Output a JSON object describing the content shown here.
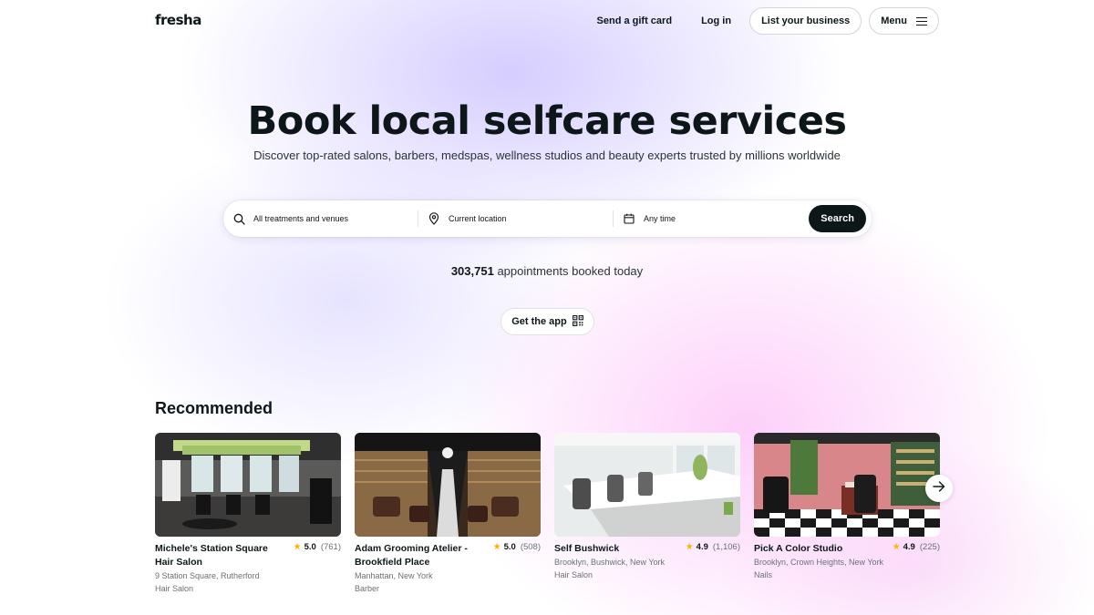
{
  "header": {
    "logo": "fresha",
    "gift_card": "Send a gift card",
    "login": "Log in",
    "list_business": "List your business",
    "menu": "Menu"
  },
  "hero": {
    "title": "Book local selfcare services",
    "subtitle": "Discover top-rated salons, barbers, medspas, wellness studios and beauty experts trusted by millions worldwide"
  },
  "search": {
    "treatments": "All treatments and venues",
    "location": "Current location",
    "time": "Any time",
    "button": "Search"
  },
  "stats": {
    "count": "303,751",
    "label": "appointments booked today"
  },
  "app_button": "Get the app",
  "recommended": {
    "title": "Recommended",
    "cards": [
      {
        "name": "Michele's Station Square Hair Salon",
        "rating": "5.0",
        "reviews": "(761)",
        "address": "9 Station Square, Rutherford",
        "category": "Hair Salon"
      },
      {
        "name": "Adam Grooming Atelier - Brookfield Place",
        "rating": "5.0",
        "reviews": "(508)",
        "address": "Manhattan, New York",
        "category": "Barber"
      },
      {
        "name": "Self Bushwick",
        "rating": "4.9",
        "reviews": "(1,106)",
        "address": "Brooklyn, Bushwick, New York",
        "category": "Hair Salon"
      },
      {
        "name": "Pick A Color Studio",
        "rating": "4.9",
        "reviews": "(225)",
        "address": "Brooklyn, Crown Heights, New York",
        "category": "Nails"
      }
    ]
  },
  "colors": {
    "text": "#0d1619",
    "star": "#f5b800",
    "button_dark": "#0d1619",
    "gradient_lavender": "#cec4ff",
    "gradient_pink": "#fdcdfa"
  },
  "icons": {
    "search": "search-icon",
    "location": "location-pin-icon",
    "calendar": "calendar-icon",
    "qr": "qr-code-icon",
    "menu": "hamburger-icon",
    "next": "arrow-right-icon",
    "star": "star-icon"
  }
}
